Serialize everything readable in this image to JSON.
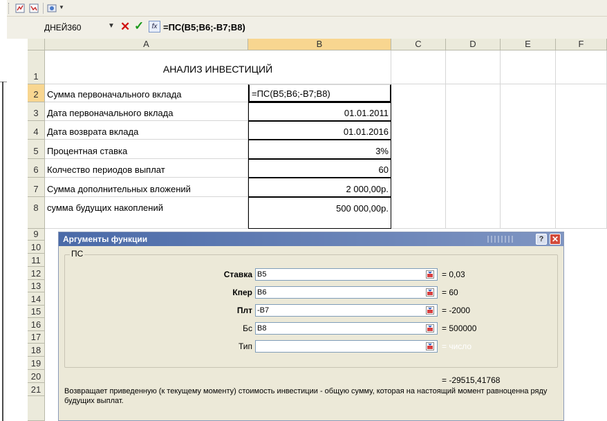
{
  "formula_bar": {
    "name_box": "ДНЕЙ360",
    "formula": "=ПС(B5;B6;-B7;B8)"
  },
  "columns": [
    "A",
    "B",
    "C",
    "D",
    "E",
    "F"
  ],
  "rows": [
    "1",
    "2",
    "3",
    "4",
    "5",
    "6",
    "7",
    "8",
    "9",
    "10",
    "11",
    "12",
    "13",
    "14",
    "15",
    "16",
    "17",
    "18",
    "19",
    "20",
    "21"
  ],
  "sheet": {
    "title": "АНАЛИЗ ИНВЕСТИЦИЙ",
    "items": [
      {
        "label": "Сумма первоначального вклада",
        "value": "=ПС(B5;B6;-B7;B8)"
      },
      {
        "label": "Дата первоначального вклада",
        "value": "01.01.2011"
      },
      {
        "label": "Дата возврата вклада",
        "value": "01.01.2016"
      },
      {
        "label": "Процентная ставка",
        "value": "3%"
      },
      {
        "label": "Колчество периодов выплат",
        "value": "60"
      },
      {
        "label": "Сумма дополнительных вложений",
        "value": "2 000,00р."
      },
      {
        "label": "сумма будущих накоплений",
        "value": "500 000,00р."
      }
    ]
  },
  "dialog": {
    "title": "Аргументы функции",
    "help": "?",
    "close": "✕",
    "function_name": "ПС",
    "args": [
      {
        "label": "Ставка",
        "value": "B5",
        "result": "= 0,03",
        "bold": true
      },
      {
        "label": "Кпер",
        "value": "B6",
        "result": "= 60",
        "bold": true
      },
      {
        "label": "Плт",
        "value": "-B7",
        "result": "= -2000",
        "bold": true
      },
      {
        "label": "Бс",
        "value": "B8",
        "result": "= 500000",
        "bold": false
      },
      {
        "label": "Тип",
        "value": "",
        "result": "= число",
        "bold": false
      }
    ],
    "total_result": "= -29515,41768",
    "description": "Возвращает приведенную (к текущему моменту) стоимость инвестиции - общую сумму, которая на настоящий момент равноценна ряду будущих выплат."
  }
}
